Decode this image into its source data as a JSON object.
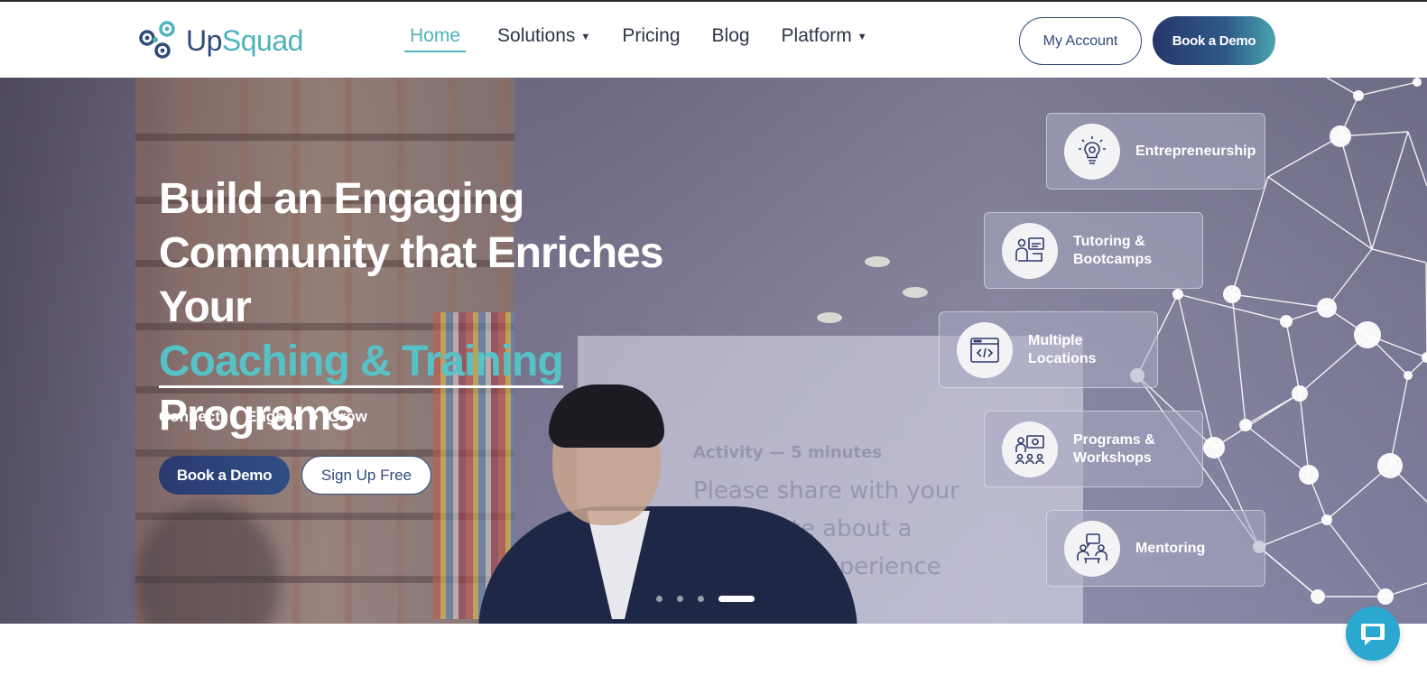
{
  "brand": {
    "logo_up": "Up",
    "logo_squad": "Squad"
  },
  "nav": {
    "items": [
      {
        "label": "Home",
        "active": true,
        "dropdown": false
      },
      {
        "label": "Solutions",
        "active": false,
        "dropdown": true
      },
      {
        "label": "Pricing",
        "active": false,
        "dropdown": false
      },
      {
        "label": "Blog",
        "active": false,
        "dropdown": false
      },
      {
        "label": "Platform",
        "active": false,
        "dropdown": true
      }
    ]
  },
  "header": {
    "account_label": "My Account",
    "demo_label": "Book a Demo"
  },
  "hero": {
    "title_line1": "Build an Engaging",
    "title_line2": "Community that Enriches",
    "title_line3_prefix": "Your ",
    "title_highlight": "Coaching & Training",
    "title_line4": "Programs",
    "tagline": [
      "Connect",
      "Engage",
      "Grow"
    ],
    "cta_primary": "Book a Demo",
    "cta_secondary": "Sign Up Free",
    "slides": {
      "count": 4,
      "active": 4
    },
    "whiteboard_text": [
      "Activity — 5 minutes",
      "Please share with your",
      "teammate about a",
      "customer experience"
    ]
  },
  "cards": [
    {
      "label": "Entrepreneurship",
      "icon": "lightbulb-gear-icon"
    },
    {
      "label": "Tutoring & Bootcamps",
      "icon": "tutor-board-icon"
    },
    {
      "label": "Multiple Locations",
      "icon": "code-window-icon"
    },
    {
      "label": "Programs & Workshops",
      "icon": "presentation-group-icon"
    },
    {
      "label": "Mentoring",
      "icon": "mentor-chat-icon"
    }
  ],
  "colors": {
    "brand_navy": "#2f4a7a",
    "brand_teal": "#4eb3bd",
    "highlight": "#56c2c7",
    "chat": "#2aa8cf"
  }
}
